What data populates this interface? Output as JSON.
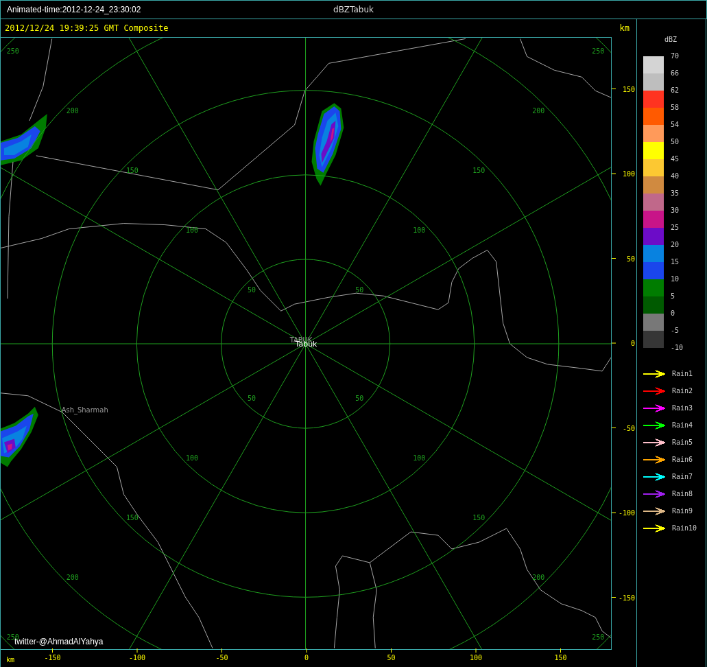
{
  "title_bar": {
    "animated_time": "Animated-time:2012-12-24_23:30:02",
    "title": "dBZTabuk"
  },
  "header": {
    "timestamp": "2012/12/24 19:39:25 GMT Composite",
    "unit": "km"
  },
  "map": {
    "range_rings": [
      {
        "labels": [
          "50",
          "50",
          "50",
          "50"
        ]
      },
      {
        "labels": [
          "100",
          "100",
          "100",
          "100"
        ]
      },
      {
        "labels": [
          "150",
          "150",
          "150",
          "150"
        ]
      },
      {
        "labels": [
          "200",
          "200",
          "200",
          "200"
        ]
      },
      {
        "labels": [
          "250",
          "250",
          "250",
          "250"
        ]
      }
    ],
    "places": [
      {
        "name": "TABUK",
        "kind": "station"
      },
      {
        "name": "Tabuk",
        "kind": "city"
      },
      {
        "name": "Ash_Sharmah",
        "kind": "town"
      }
    ],
    "credit": "twitter-@AhmadAlYahya"
  },
  "y_axis": {
    "ticks": [
      "150",
      "100",
      "50",
      "0",
      "-50",
      "-100",
      "-150"
    ]
  },
  "x_axis": {
    "unit": "km",
    "ticks": [
      "-150",
      "-100",
      "-50",
      "0",
      "50",
      "100",
      "150"
    ]
  },
  "legend": {
    "title": "dBZ",
    "bins": [
      {
        "color": "#d4d4d4"
      },
      {
        "color": "#bebebe"
      },
      {
        "color": "#ff3320"
      },
      {
        "color": "#ff5a00"
      },
      {
        "color": "#ff9a5a"
      },
      {
        "color": "#ffff00"
      },
      {
        "color": "#fcc832"
      },
      {
        "color": "#d08a40"
      },
      {
        "color": "#c0688a"
      },
      {
        "color": "#c81488"
      },
      {
        "color": "#6c0cc8"
      },
      {
        "color": "#0882e0"
      },
      {
        "color": "#1a46ec"
      },
      {
        "color": "#007c00"
      },
      {
        "color": "#005a00"
      },
      {
        "color": "#787878"
      },
      {
        "color": "#363636"
      }
    ],
    "labels": [
      "70",
      "66",
      "62",
      "58",
      "54",
      "50",
      "45",
      "40",
      "35",
      "30",
      "25",
      "20",
      "15",
      "10",
      "5",
      "0",
      "-5",
      "-10"
    ],
    "tracks": [
      {
        "label": "Rain1",
        "color": "#ffff00"
      },
      {
        "label": "Rain2",
        "color": "#ff0000"
      },
      {
        "label": "Rain3",
        "color": "#ff00ff"
      },
      {
        "label": "Rain4",
        "color": "#00ff00"
      },
      {
        "label": "Rain5",
        "color": "#ffc0cb"
      },
      {
        "label": "Rain6",
        "color": "#ffa500"
      },
      {
        "label": "Rain7",
        "color": "#00ffff"
      },
      {
        "label": "Rain8",
        "color": "#a020f0"
      },
      {
        "label": "Rain9",
        "color": "#deb887"
      },
      {
        "label": "Rain10",
        "color": "#ffff00"
      }
    ]
  }
}
